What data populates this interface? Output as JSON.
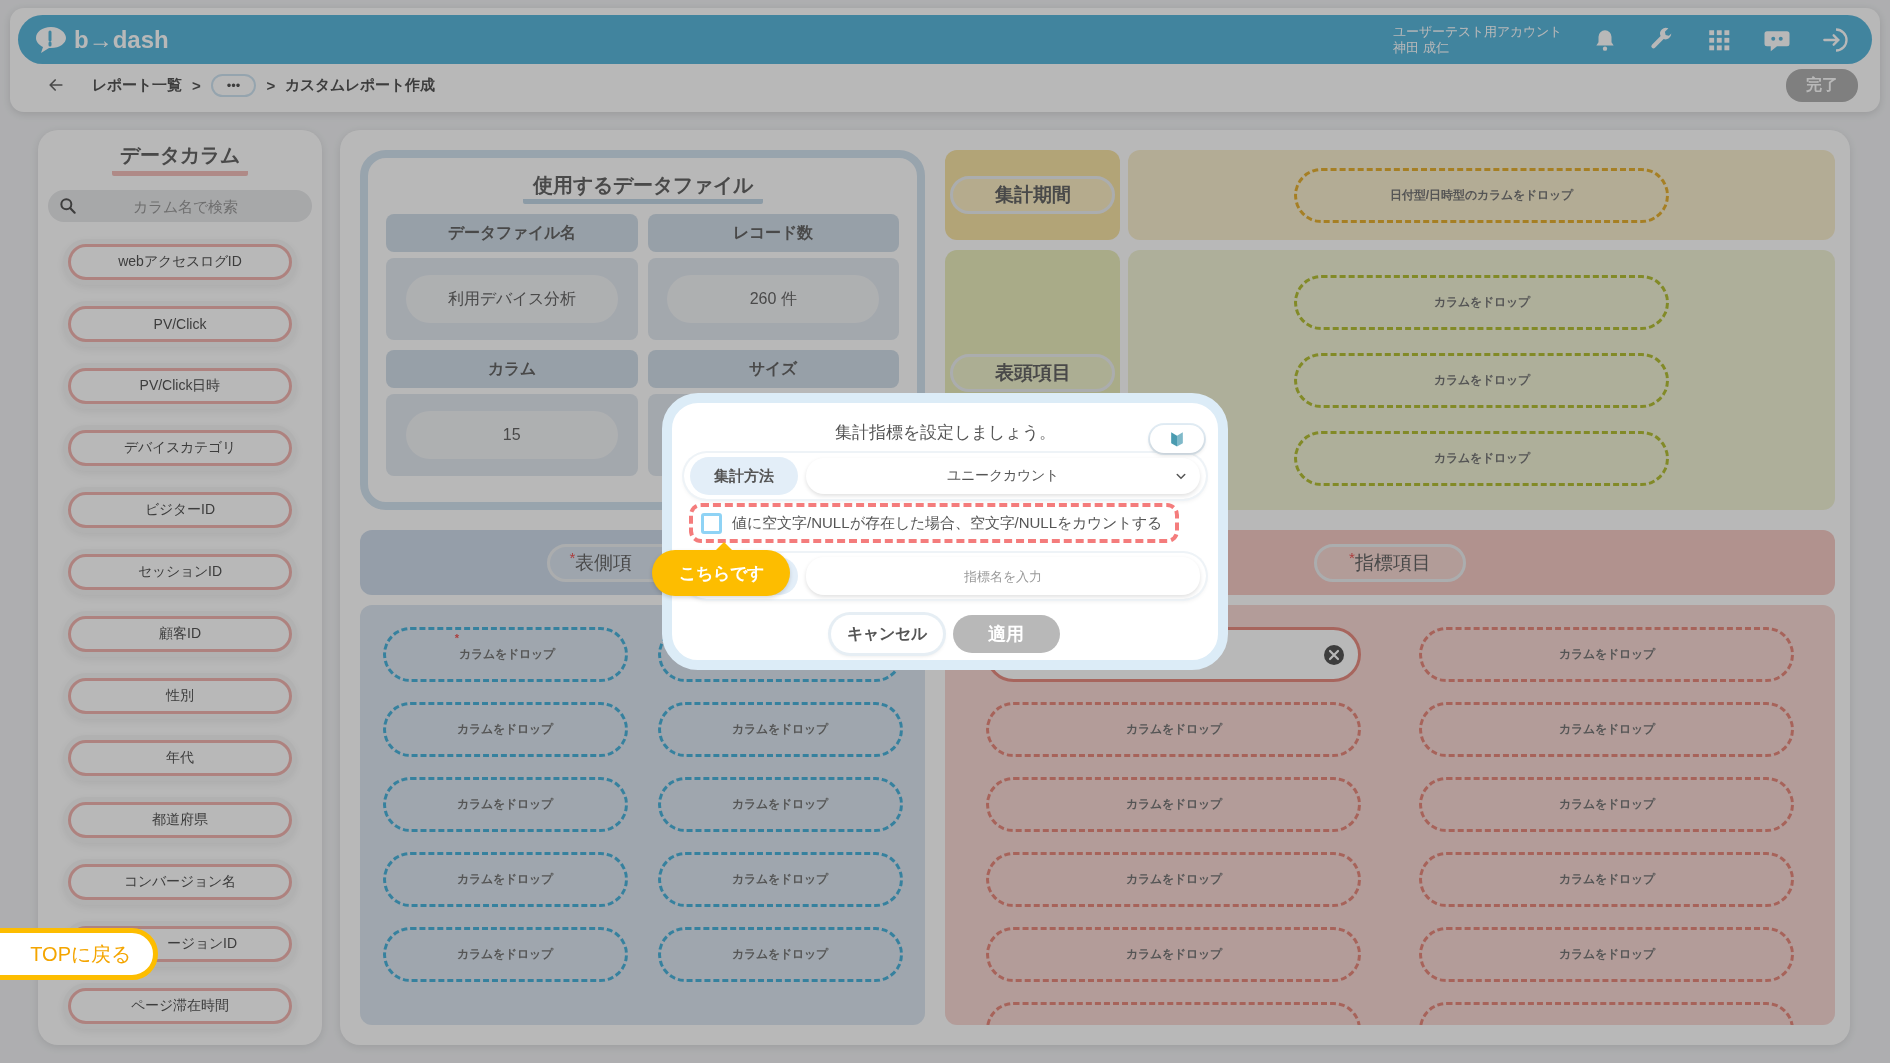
{
  "header": {
    "logo": "b→dash",
    "account": "ユーザーテスト用アカウント",
    "user": "神田 成仁"
  },
  "breadcrumb": [
    {
      "kind": "link",
      "label": "レポート一覧"
    },
    {
      "kind": "separator",
      "label": ">"
    },
    {
      "kind": "more",
      "label": "•••"
    },
    {
      "kind": "separator",
      "label": ">"
    },
    {
      "kind": "current",
      "label": "カスタムレポート作成"
    }
  ],
  "done_button": {
    "label": "完了",
    "disabled": true
  },
  "sidebar": {
    "title": "データカラム",
    "search": {
      "placeholder": "カラム名で検索"
    },
    "columns": [
      {
        "label": "webアクセスログID",
        "cut_off_left": false
      },
      {
        "label": "PV/Click",
        "cut_off_left": false
      },
      {
        "label": "PV/Click日時",
        "cut_off_left": false
      },
      {
        "label": "デバイスカテゴリ",
        "cut_off_left": false
      },
      {
        "label": "ビジターID",
        "cut_off_left": false
      },
      {
        "label": "セッションID",
        "cut_off_left": false
      },
      {
        "label": "顧客ID",
        "cut_off_left": false
      },
      {
        "label": "性別",
        "cut_off_left": false
      },
      {
        "label": "年代",
        "cut_off_left": false
      },
      {
        "label": "都道府県",
        "cut_off_left": false
      },
      {
        "label": "コンバージョン名",
        "cut_off_left": false
      },
      {
        "label": "ージョンID",
        "cut_off_left": true
      },
      {
        "label": "ページ滞在時間",
        "cut_off_left": false
      }
    ]
  },
  "data_file": {
    "title": "使用するデータファイル",
    "cells": [
      {
        "label": "データファイル名",
        "value": "利用デバイス分析"
      },
      {
        "label": "レコード数",
        "value": "260 件"
      },
      {
        "label": "カラム",
        "value": "15"
      },
      {
        "label": "サイズ"
      }
    ]
  },
  "period": {
    "label": "集計期間",
    "drops": [
      "日付型/日時型のカラムをドロップ"
    ]
  },
  "column_header": {
    "label": "表頭項目",
    "drops": [
      "カラムをドロップ",
      "カラムをドロップ",
      "カラムをドロップ"
    ]
  },
  "row_header": {
    "mark": "*",
    "label": "表側項",
    "drops": [
      {
        "kind": "drop",
        "mark": "*",
        "text": "カラムをドロップ"
      },
      {
        "kind": "drop"
      },
      {
        "kind": "drop",
        "text": "カラムをドロップ"
      },
      {
        "kind": "drop",
        "text": "カラムをドロップ"
      },
      {
        "kind": "drop",
        "text": "カラムをドロップ"
      },
      {
        "kind": "drop",
        "text": "カラムをドロップ"
      },
      {
        "kind": "drop",
        "text": "カラムをドロップ"
      },
      {
        "kind": "drop",
        "text": "カラムをドロップ"
      },
      {
        "kind": "drop",
        "text": "カラムをドロップ"
      },
      {
        "kind": "drop",
        "text": "カラムをドロップ"
      }
    ]
  },
  "metrics": {
    "mark": "*",
    "label": "指標項目",
    "slots": [
      {
        "kind": "filled"
      },
      {
        "kind": "drop",
        "text": "カラムをドロップ"
      },
      {
        "kind": "drop",
        "text": "カラムをドロップ"
      },
      {
        "kind": "drop",
        "text": "カラムをドロップ"
      },
      {
        "kind": "drop",
        "text": "カラムをドロップ"
      },
      {
        "kind": "drop",
        "text": "カラムをドロップ"
      },
      {
        "kind": "drop",
        "text": "カラムをドロップ"
      },
      {
        "kind": "drop",
        "text": "カラムをドロップ"
      },
      {
        "kind": "drop",
        "text": "カラムをドロップ"
      },
      {
        "kind": "drop",
        "text": "カラムをドロップ"
      },
      {
        "kind": "drop"
      },
      {
        "kind": "drop"
      }
    ]
  },
  "modal": {
    "title": "集計指標を設定しましょう。",
    "method_label": "集計方法",
    "method_value": "ユニークカウント",
    "checkbox": {
      "label": "値に空文字/NULLが存在した場合、空文字/NULLをカウントする",
      "checked": false
    },
    "name_field": {
      "placeholder": "指標名を入力"
    },
    "buttons": [
      {
        "label": "キャンセル",
        "disabled": false
      },
      {
        "label": "適用",
        "disabled": true
      }
    ]
  },
  "tooltip": "こちらです",
  "top_button": "TOPに戻る"
}
